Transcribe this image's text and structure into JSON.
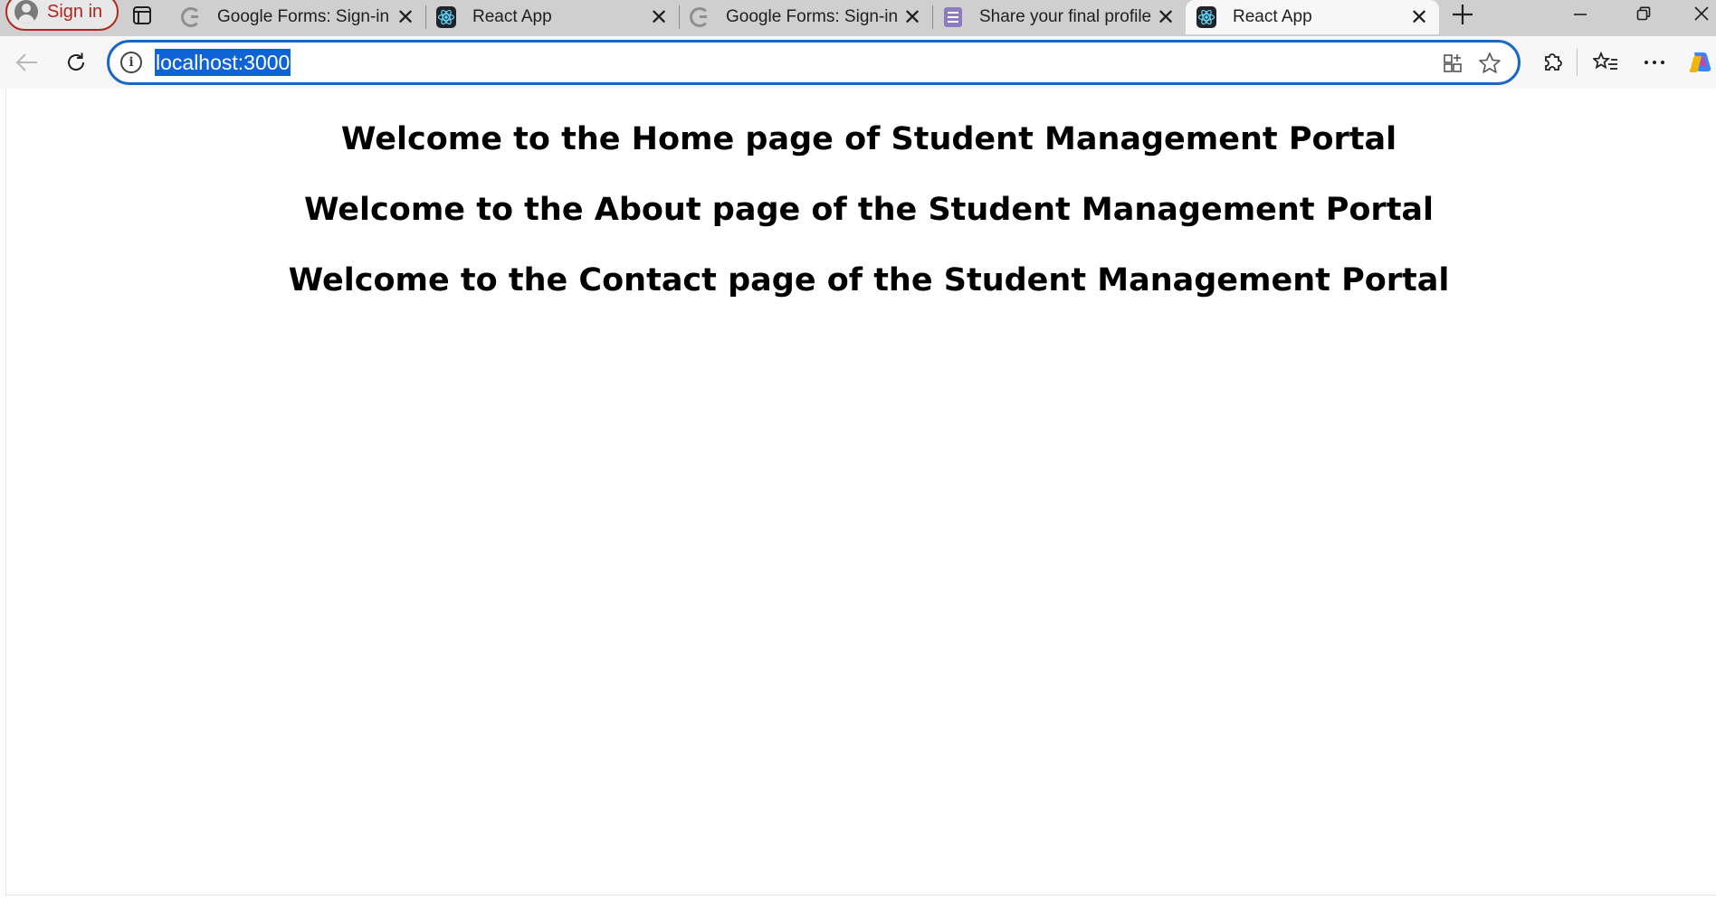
{
  "browser": {
    "signin_label": "Sign in",
    "tabs": [
      {
        "title": "Google Forms: Sign-in",
        "favicon": "google-icon"
      },
      {
        "title": "React App",
        "favicon": "react-icon"
      },
      {
        "title": "Google Forms: Sign-in",
        "favicon": "google-icon"
      },
      {
        "title": "Share your final profile",
        "favicon": "forms-icon"
      },
      {
        "title": "React App",
        "favicon": "react-icon",
        "active": true
      }
    ],
    "address": "localhost:3000",
    "accent_color": "#1a67c9",
    "selection_color": "#0f63d4"
  },
  "page": {
    "headings": [
      "Welcome to the Home page of Student Management Portal",
      "Welcome to the About page of the Student Management Portal",
      "Welcome to the Contact page of the Student Management Portal"
    ]
  }
}
